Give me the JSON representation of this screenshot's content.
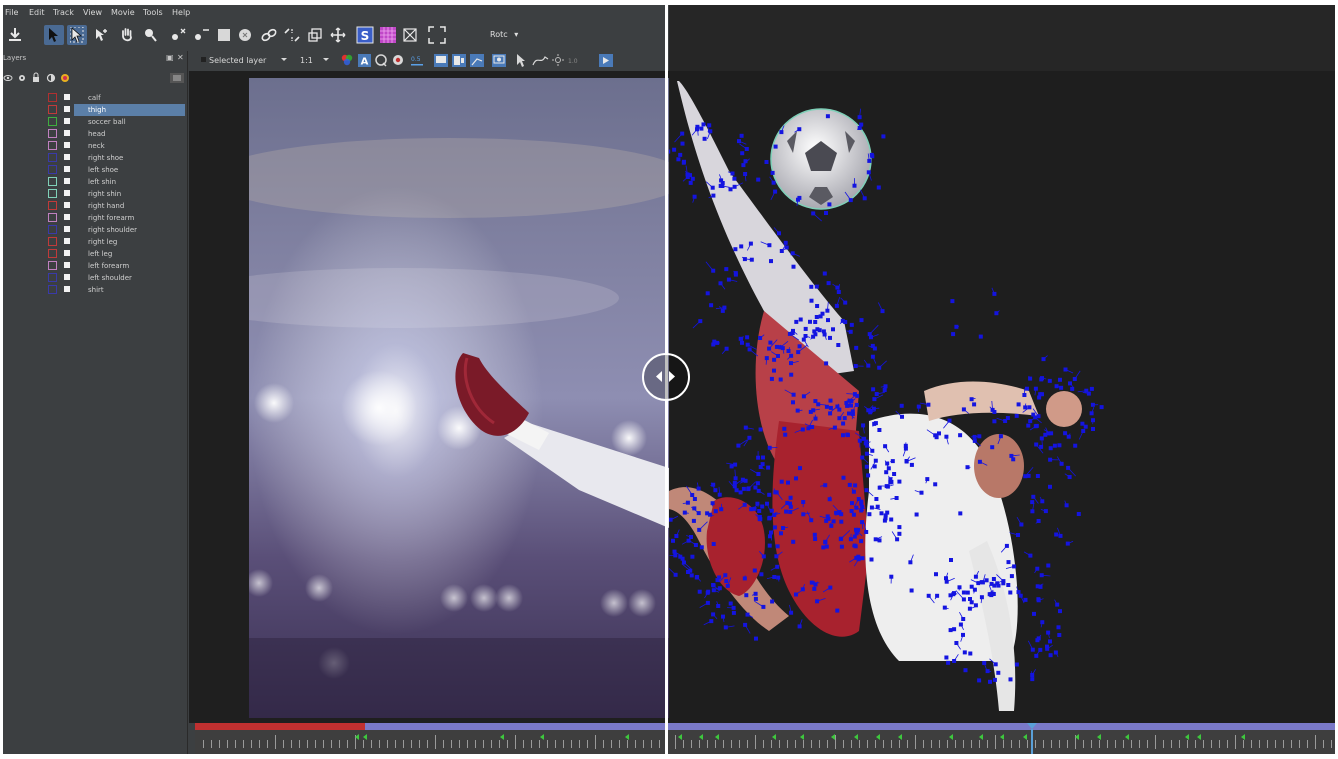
{
  "menu": {
    "file": "File",
    "edit": "Edit",
    "track": "Track",
    "view": "View",
    "movie": "Movie",
    "tools": "Tools",
    "help": "Help"
  },
  "toolbar": {
    "rotate_label": "Rotc",
    "layer_select": "Selected layer",
    "zoom_select": "1:1",
    "opacity_value": "0.5"
  },
  "layers_panel": {
    "title": "Layers",
    "layers": [
      {
        "name": "calf",
        "color": "#b03030",
        "selected": false
      },
      {
        "name": "thigh",
        "color": "#c03a3a",
        "selected": true
      },
      {
        "name": "soccer ball",
        "color": "#3fae3f",
        "selected": false
      },
      {
        "name": "head",
        "color": "#c080c0",
        "selected": false
      },
      {
        "name": "neck",
        "color": "#c080c0",
        "selected": false
      },
      {
        "name": "right shoe",
        "color": "#3a3aa8",
        "selected": false
      },
      {
        "name": "left shoe",
        "color": "#3a3aa8",
        "selected": false
      },
      {
        "name": "left shin",
        "color": "#7fd0b8",
        "selected": false
      },
      {
        "name": "right shin",
        "color": "#7fd0b8",
        "selected": false
      },
      {
        "name": "right hand",
        "color": "#c03a3a",
        "selected": false
      },
      {
        "name": "right forearm",
        "color": "#c080c0",
        "selected": false
      },
      {
        "name": "right shoulder",
        "color": "#3a3aa8",
        "selected": false
      },
      {
        "name": "right leg",
        "color": "#c03a3a",
        "selected": false
      },
      {
        "name": "left leg",
        "color": "#c03a3a",
        "selected": false
      },
      {
        "name": "left forearm",
        "color": "#c080c0",
        "selected": false
      },
      {
        "name": "left shoulder",
        "color": "#3a3aa8",
        "selected": false
      },
      {
        "name": "shirt",
        "color": "#3a3aa8",
        "selected": false
      }
    ]
  },
  "colors": {
    "tracking_points": "#1414e0",
    "timeline_range": "#c03030",
    "timeline_bar": "#7a79c8",
    "keyframe": "#3ec83e",
    "playhead": "#5aa0d8"
  }
}
